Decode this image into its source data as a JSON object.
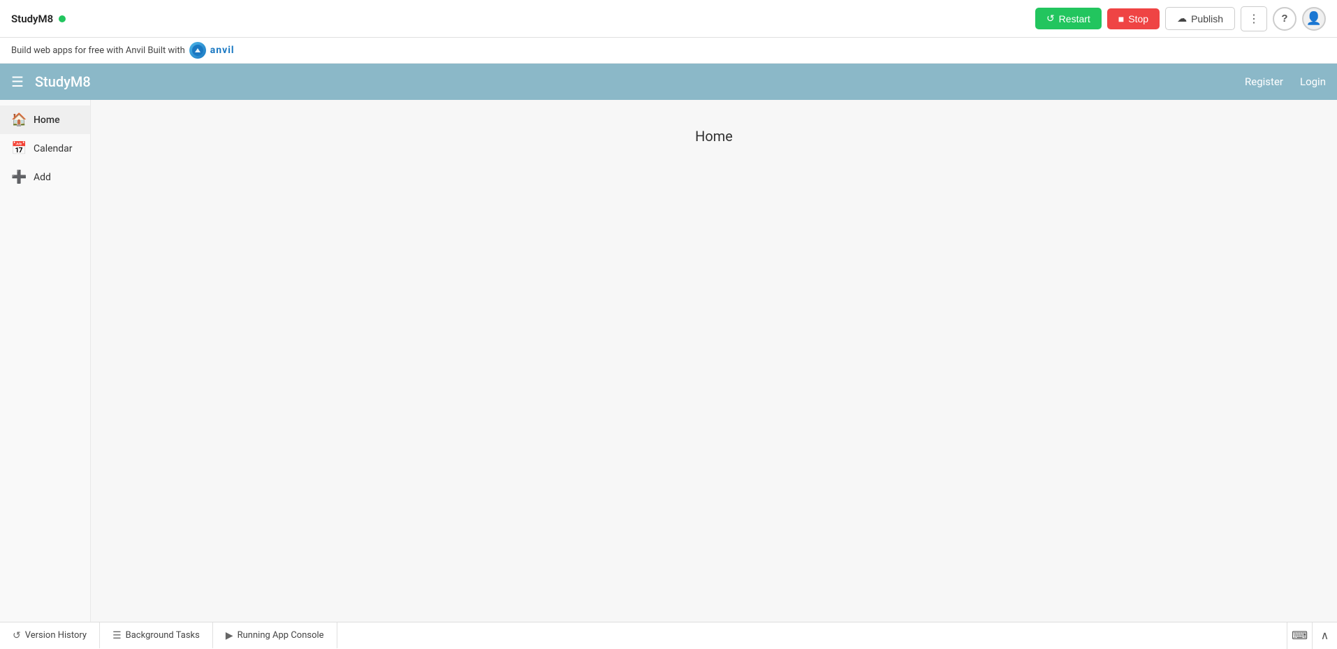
{
  "toolbar": {
    "app_name": "StudyM8",
    "status": "online",
    "restart_label": "Restart",
    "stop_label": "Stop",
    "publish_label": "Publish",
    "more_icon": "⋮",
    "help_icon": "?",
    "avatar_icon": "👤"
  },
  "banner": {
    "text": "Build web apps for free with Anvil Built with",
    "logo_text": "anvil"
  },
  "app": {
    "navbar": {
      "title": "StudyM8",
      "register_label": "Register",
      "login_label": "Login"
    },
    "sidebar": {
      "items": [
        {
          "label": "Home",
          "icon": "🏠",
          "active": true
        },
        {
          "label": "Calendar",
          "icon": "📅",
          "active": false
        },
        {
          "label": "Add",
          "icon": "➕",
          "active": false
        }
      ]
    },
    "main": {
      "page_title": "Home"
    }
  },
  "bottom_bar": {
    "tabs": [
      {
        "label": "Version History",
        "icon": "↺"
      },
      {
        "label": "Background Tasks",
        "icon": "☰"
      },
      {
        "label": "Running App Console",
        "icon": "▶"
      }
    ],
    "expand_icon": "⌨",
    "collapse_icon": "∧"
  }
}
